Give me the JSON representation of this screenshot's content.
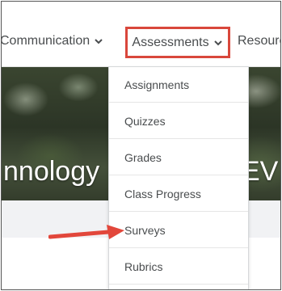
{
  "navbar": {
    "items": [
      {
        "label": "Communication",
        "has_chevron": true
      },
      {
        "label": "Assessments",
        "has_chevron": true,
        "highlighted": true
      },
      {
        "label": "Resourc",
        "has_chevron": false
      }
    ]
  },
  "banner": {
    "left_text": "nnology",
    "right_text": "EV"
  },
  "dropdown": {
    "items": [
      {
        "label": "Assignments"
      },
      {
        "label": "Quizzes"
      },
      {
        "label": "Grades"
      },
      {
        "label": "Class Progress"
      },
      {
        "label": "Surveys",
        "annotated": true
      },
      {
        "label": "Rubrics"
      }
    ]
  },
  "colors": {
    "highlight_border": "#d9473c",
    "arrow": "#e2473b",
    "text": "#494c4e"
  },
  "icons": {
    "chevron": "chevron-down-icon",
    "annotation": "arrow-annotation"
  }
}
